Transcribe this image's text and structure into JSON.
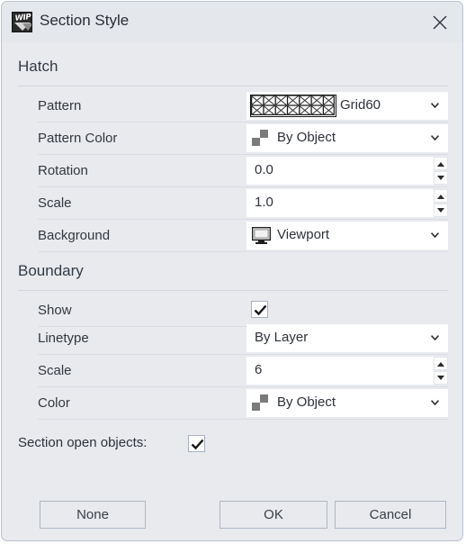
{
  "window": {
    "title": "Section Style",
    "icon": "wip-icon",
    "icon_text": "WIP",
    "close_icon": "close-icon"
  },
  "sections": [
    {
      "id": "hatch",
      "heading": "Hatch",
      "rows": [
        {
          "label": "Pattern",
          "control": "dropdown",
          "swatch": "hatch-pattern-swatch",
          "value": "Grid60"
        },
        {
          "label": "Pattern Color",
          "control": "dropdown",
          "swatch": "checker-swatch",
          "value": "By Object"
        },
        {
          "label": "Rotation",
          "control": "spinner",
          "value": "0.0"
        },
        {
          "label": "Scale",
          "control": "spinner",
          "value": "1.0"
        },
        {
          "label": "Background",
          "control": "dropdown",
          "swatch": "monitor-icon",
          "value": "Viewport"
        }
      ]
    },
    {
      "id": "boundary",
      "heading": "Boundary",
      "rows": [
        {
          "label": "Show",
          "control": "checkbox",
          "checked": true
        },
        {
          "label": "Linetype",
          "control": "dropdown",
          "value": "By Layer"
        },
        {
          "label": "Scale",
          "control": "spinner",
          "value": "6"
        },
        {
          "label": "Color",
          "control": "dropdown",
          "swatch": "checker-swatch",
          "value": "By Object"
        }
      ]
    }
  ],
  "section_open_objects": {
    "label": "Section open objects:",
    "checked": true
  },
  "footer": {
    "none_label": "None",
    "ok_label": "OK",
    "cancel_label": "Cancel"
  },
  "colors": {
    "dialog_bg": "#e8eaee",
    "titlebar_bg": "#e4e7ec",
    "field_bg": "#ffffff",
    "border": "#b9c2d0",
    "text": "#2d3139",
    "checker_gray": "#7b7b7b"
  }
}
